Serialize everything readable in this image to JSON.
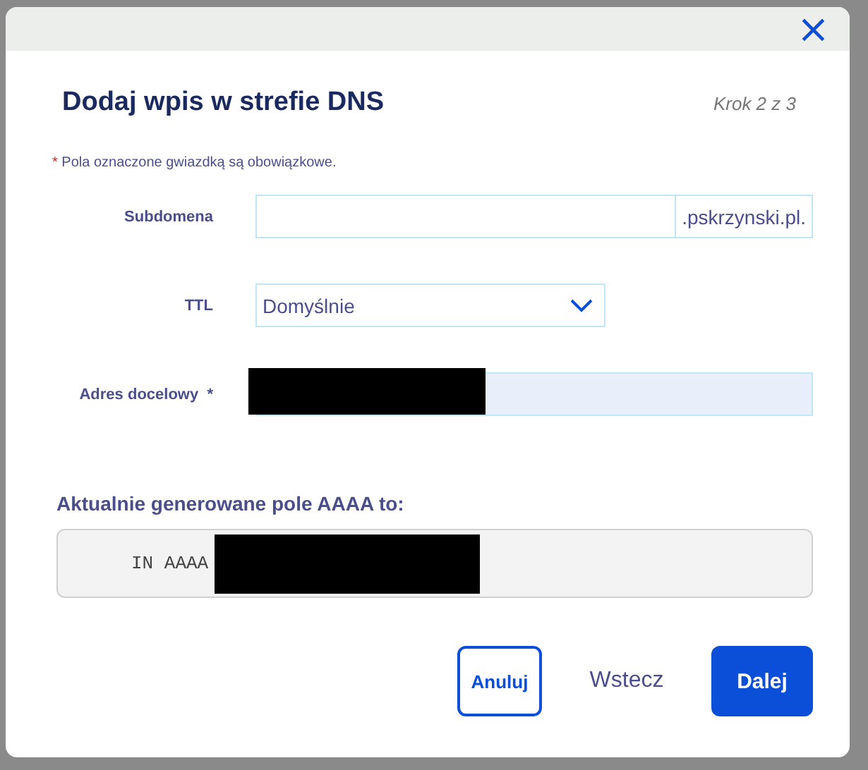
{
  "dialog": {
    "close_icon": "×",
    "title": "Dodaj wpis w strefie DNS",
    "step": "Krok 2 z 3",
    "required_note": {
      "mark": "*",
      "text": "Pola oznaczone gwiazdką są obowiązkowe."
    }
  },
  "fields": [
    {
      "kind": "suffix",
      "label": "Subdomena",
      "suffix": ".pskrzynski.pl."
    },
    {
      "kind": "select",
      "label": "TTL",
      "value": "Domyślnie"
    },
    {
      "kind": "redacted",
      "label": "Adres docelowy",
      "required_mark": "*"
    }
  ],
  "generated": {
    "label": "Aktualnie generowane pole AAAA to:",
    "prefix": "IN AAAA"
  },
  "buttons": [
    {
      "kind": "outline",
      "label": "Anuluj"
    },
    {
      "kind": "text",
      "label": "Wstecz"
    },
    {
      "kind": "primary",
      "label": "Dalej"
    }
  ]
}
